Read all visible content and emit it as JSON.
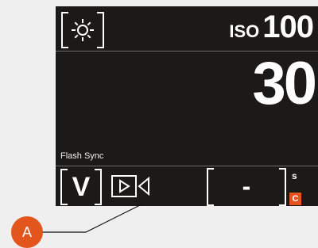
{
  "screen": {
    "white_balance_icon": "sun-icon",
    "iso": {
      "label": "ISO",
      "value": "100"
    },
    "shutter_speed": "30",
    "flash_label": "Flash Sync",
    "mode": "V",
    "video_icon": "video-camera-icon",
    "drive_value": "-",
    "unit": "s",
    "badge": "C"
  },
  "callout": {
    "label": "A"
  },
  "colors": {
    "screen_bg": "#1b1a18",
    "accent": "#e2561e",
    "page_bg": "#efefef"
  }
}
